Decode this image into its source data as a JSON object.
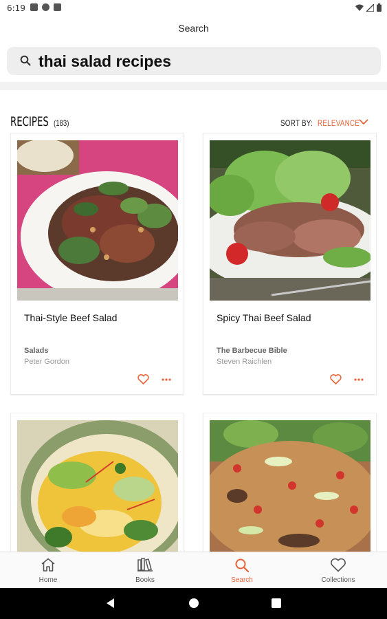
{
  "status_bar": {
    "time": "6:19"
  },
  "header": {
    "title": "Search"
  },
  "search": {
    "query": "thai salad recipes",
    "icon": "search-icon"
  },
  "results": {
    "title": "RECIPES",
    "count": "(183)",
    "sort_label": "SORT BY:",
    "sort_value": "RELEVANCE",
    "accent_color": "#e8633a"
  },
  "recipes": [
    {
      "title": "Thai-Style Beef Salad",
      "category": "Salads",
      "author": "Peter Gordon"
    },
    {
      "title": "Spicy Thai Beef Salad",
      "category": "The Barbecue Bible",
      "author": "Steven Raichlen"
    },
    {
      "title": "",
      "category": "",
      "author": ""
    },
    {
      "title": "",
      "category": "",
      "author": ""
    }
  ],
  "bottom_nav": {
    "items": [
      {
        "label": "Home",
        "icon": "home-icon"
      },
      {
        "label": "Books",
        "icon": "books-icon"
      },
      {
        "label": "Search",
        "icon": "search-icon"
      },
      {
        "label": "Collections",
        "icon": "heart-icon"
      }
    ],
    "active": "Search"
  }
}
